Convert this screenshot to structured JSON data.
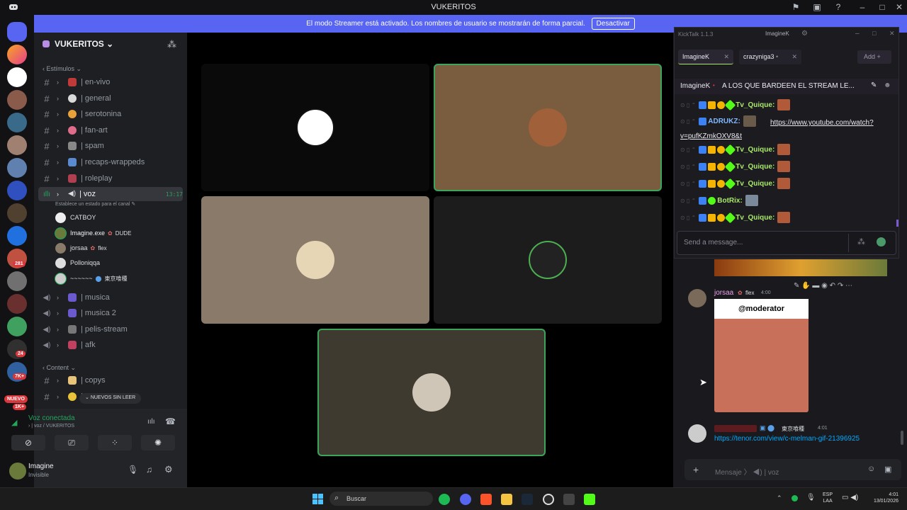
{
  "window": {
    "title": "VUKERITOS"
  },
  "banner": {
    "text": "El modo Streamer está activado. Los nombres de usuario se mostrarán de forma parcial.",
    "button": "Desactivar"
  },
  "server": {
    "name": "VUKERITOS"
  },
  "rail_badges": [
    "281",
    "24",
    "7K+",
    "NUEVO",
    "1K+"
  ],
  "categories": {
    "stimulus": "Estímulos",
    "content": "Content"
  },
  "channels": [
    {
      "name": "| en-vivo",
      "type": "text"
    },
    {
      "name": "| general",
      "type": "text"
    },
    {
      "name": "| serotonina",
      "type": "text"
    },
    {
      "name": "| fan-art",
      "type": "text"
    },
    {
      "name": "| spam",
      "type": "text"
    },
    {
      "name": "| recaps-wrappeds",
      "type": "text"
    },
    {
      "name": "| roleplay",
      "type": "text"
    },
    {
      "name": "| voz",
      "type": "voice",
      "time": "13:17",
      "status_hint": "Establece un estado para el canal"
    },
    {
      "name": "| musica",
      "type": "voice"
    },
    {
      "name": "| musica 2",
      "type": "voice"
    },
    {
      "name": "| pelis-stream",
      "type": "voice"
    },
    {
      "name": "| afk",
      "type": "voice"
    },
    {
      "name": "| copys",
      "type": "text"
    },
    {
      "name": "|",
      "type": "text"
    }
  ],
  "voice_users": [
    {
      "name": "CATBOY",
      "tag": ""
    },
    {
      "name": "Imagine.exe",
      "tag": "DUDE"
    },
    {
      "name": "jorsaa",
      "tag": "flex"
    },
    {
      "name": "Polloniqqa",
      "tag": ""
    },
    {
      "name": "~~~~~~",
      "tag": "東京喰種"
    }
  ],
  "unread_pill": "NUEVOS SIN LEER",
  "voice_status": {
    "title": "Voz conectada",
    "subtitle": "| voz / VUKERITOS"
  },
  "user_panel": {
    "name": "Imagine",
    "status": "Invisible"
  },
  "kicktalk": {
    "version": "KickTalk 1.1.3",
    "account": "ImagineK",
    "tabs": [
      "ImagineK",
      "crazyniga3"
    ],
    "add_label": "Add",
    "pinned_user": "ImagineK",
    "pinned_text": "A LOS QUE BARDEEN EL STREAM LE...",
    "messages": [
      {
        "user": "Tv_Quique:",
        "text": ""
      },
      {
        "user": "ADRUKZ:",
        "text": "https://www.youtube.com/watch?v=pufKZmkOXV8&t"
      },
      {
        "user": "Tv_Quique:",
        "text": ""
      },
      {
        "user": "Tv_Quique:",
        "text": ""
      },
      {
        "user": "Tv_Quique:",
        "text": ""
      },
      {
        "user": "BotRix:",
        "text": ""
      },
      {
        "user": "Tv_Quique:",
        "text": ""
      }
    ],
    "input_placeholder": "Send a message..."
  },
  "chat": {
    "msg1": {
      "user": "jorsaa",
      "tag": "flex",
      "time": "4:00",
      "gif_caption": "@moderator"
    },
    "msg2": {
      "tag": "東京喰種",
      "time": "4:01",
      "link": "https://tenor.com/view/c-melman-gif-21396925"
    },
    "input_placeholder": "Mensaje",
    "input_channel": "| voz"
  },
  "taskbar": {
    "search": "Buscar",
    "lang": "ESP",
    "region": "LAA",
    "time": "4:01",
    "date": "13/01/2026"
  },
  "colors": {
    "blurple": "#5865f2",
    "kick_green": "#a8e86a",
    "link": "#00a8fc"
  }
}
